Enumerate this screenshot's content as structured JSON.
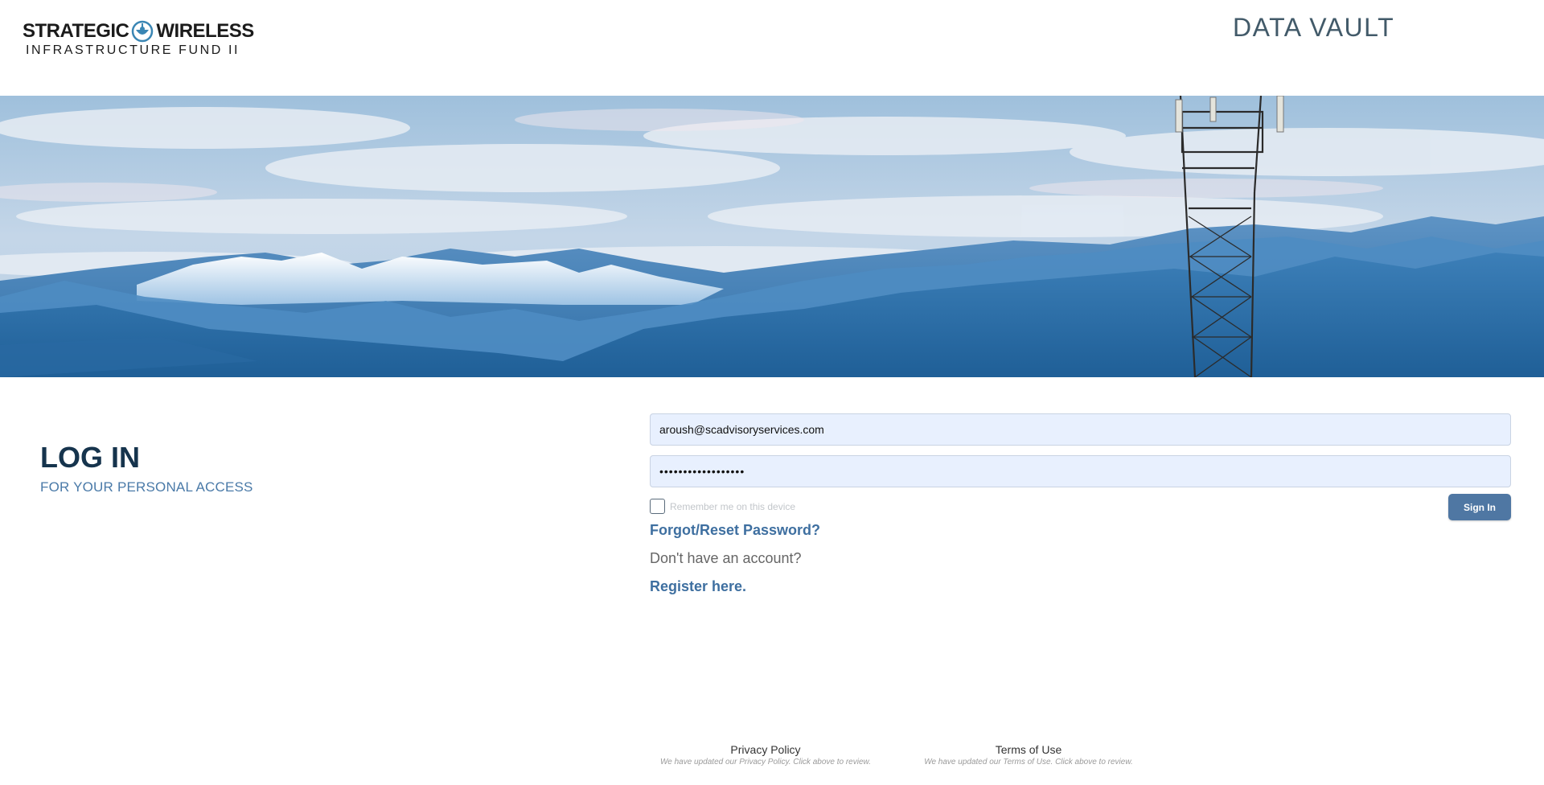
{
  "header": {
    "logo": {
      "line1_left": "STRATEGIC",
      "line1_right": "WIRELESS",
      "line2": "INFRASTRUCTURE FUND II",
      "mark_icon": "eye-antenna-logo-icon",
      "mark_color": "#3a86b4"
    },
    "site_title": "DATA VAULT"
  },
  "banner": {
    "description_icon": "mountain-cell-tower-banner"
  },
  "login": {
    "heading": "LOG IN",
    "subheading": "FOR YOUR PERSONAL ACCESS",
    "email_value": "aroush@scadvisoryservices.com",
    "password_value": "••••••••••••••••••",
    "remember_label": "Remember me on this device",
    "remember_checked": false,
    "signin_label": "Sign In",
    "forgot_label": "Forgot/Reset Password?",
    "no_account_text": "Don't have an account?",
    "register_label": "Register here."
  },
  "footer": {
    "privacy_label": "Privacy Policy",
    "privacy_note": "We have updated our Privacy Policy. Click above to review.",
    "terms_label": "Terms of Use",
    "terms_note": "We have updated our Terms of Use. Click above to review."
  },
  "colors": {
    "heading": "#16344d",
    "accent": "#4a7aa8",
    "link": "#3e6fa0",
    "button": "#4f77a3",
    "title": "#425a69",
    "input_bg": "#e8f0fe"
  }
}
